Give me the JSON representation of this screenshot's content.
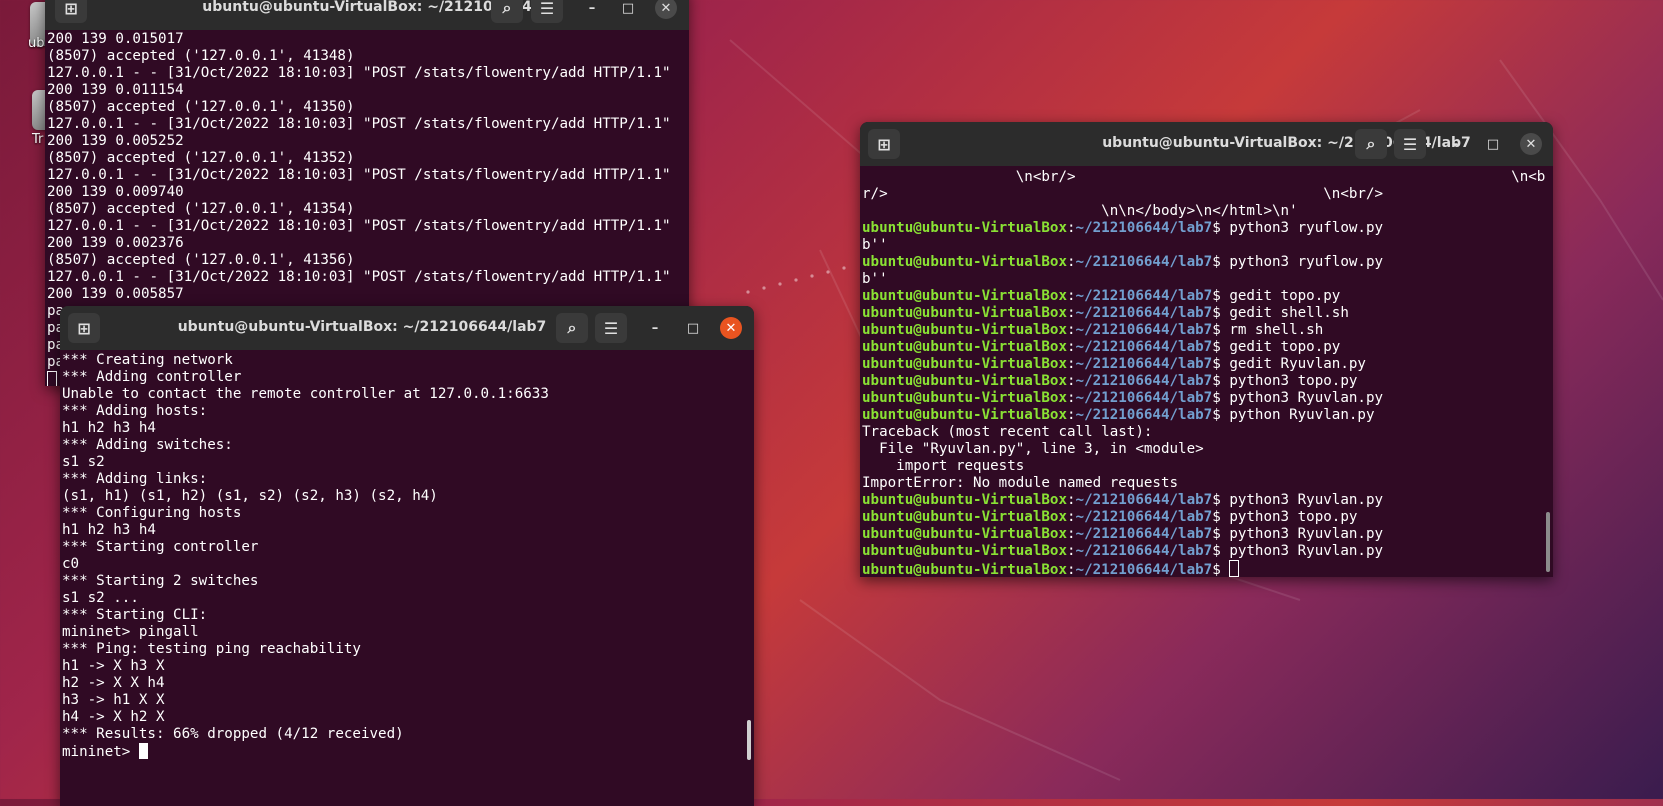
{
  "desktop": {
    "icons": [
      {
        "label": "ubu"
      },
      {
        "label": "Tr"
      }
    ]
  },
  "window_left_top": {
    "title": "ubuntu@ubuntu-VirtualBox: ~/212106644",
    "lines": [
      "200 139 0.015017",
      "(8507) accepted ('127.0.0.1', 41348)",
      "127.0.0.1 - - [31/Oct/2022 18:10:03] \"POST /stats/flowentry/add HTTP/1.1\"",
      "200 139 0.011154",
      "(8507) accepted ('127.0.0.1', 41350)",
      "127.0.0.1 - - [31/Oct/2022 18:10:03] \"POST /stats/flowentry/add HTTP/1.1\"",
      "200 139 0.005252",
      "(8507) accepted ('127.0.0.1', 41352)",
      "127.0.0.1 - - [31/Oct/2022 18:10:03] \"POST /stats/flowentry/add HTTP/1.1\"",
      "200 139 0.009740",
      "(8507) accepted ('127.0.0.1', 41354)",
      "127.0.0.1 - - [31/Oct/2022 18:10:03] \"POST /stats/flowentry/add HTTP/1.1\"",
      "200 139 0.002376",
      "(8507) accepted ('127.0.0.1', 41356)",
      "127.0.0.1 - - [31/Oct/2022 18:10:03] \"POST /stats/flowentry/add HTTP/1.1\"",
      "200 139 0.005857",
      "pa",
      "pa",
      "pa",
      "pa"
    ]
  },
  "window_bottom": {
    "title": "ubuntu@ubuntu-VirtualBox: ~/212106644/lab7",
    "lines": [
      "*** Creating network",
      "*** Adding controller",
      "Unable to contact the remote controller at 127.0.0.1:6633",
      "*** Adding hosts:",
      "h1 h2 h3 h4",
      "*** Adding switches:",
      "s1 s2",
      "*** Adding links:",
      "(s1, h1) (s1, h2) (s1, s2) (s2, h3) (s2, h4)",
      "*** Configuring hosts",
      "h1 h2 h3 h4",
      "*** Starting controller",
      "c0",
      "*** Starting 2 switches",
      "s1 s2 ...",
      "*** Starting CLI:",
      "mininet> pingall",
      "*** Ping: testing ping reachability",
      "h1 -> X h3 X",
      "h2 -> X X h4",
      "h3 -> h1 X X",
      "h4 -> X h2 X",
      "*** Results: 66% dropped (4/12 received)"
    ],
    "prompt": "mininet> "
  },
  "window_right": {
    "title": "ubuntu@ubuntu-VirtualBox: ~/212106644/lab7",
    "html_lines": [
      "                  \\n<br/>                                                   \\n<b",
      "r/>                                                   \\n<br/>",
      "                            \\n\\n</body>\\n</html>\\n'"
    ],
    "prompt_user": "ubuntu@ubuntu-VirtualBox",
    "prompt_path": "~/212106644/lab7",
    "entries": [
      {
        "type": "cmd",
        "text": "python3 ryuflow.py"
      },
      {
        "type": "out",
        "text": "b''"
      },
      {
        "type": "cmd",
        "text": "python3 ryuflow.py"
      },
      {
        "type": "out",
        "text": "b''"
      },
      {
        "type": "cmd",
        "text": "gedit topo.py"
      },
      {
        "type": "cmd",
        "text": "gedit shell.sh"
      },
      {
        "type": "cmd",
        "text": "rm shell.sh"
      },
      {
        "type": "cmd",
        "text": "gedit topo.py"
      },
      {
        "type": "cmd",
        "text": "gedit Ryuvlan.py"
      },
      {
        "type": "cmd",
        "text": "python3 topo.py"
      },
      {
        "type": "cmd",
        "text": "python3 Ryuvlan.py"
      },
      {
        "type": "cmd",
        "text": "python Ryuvlan.py"
      },
      {
        "type": "out",
        "text": "Traceback (most recent call last):"
      },
      {
        "type": "out",
        "text": "  File \"Ryuvlan.py\", line 3, in <module>"
      },
      {
        "type": "out",
        "text": "    import requests"
      },
      {
        "type": "out",
        "text": "ImportError: No module named requests"
      },
      {
        "type": "cmd",
        "text": "python3 Ryuvlan.py"
      },
      {
        "type": "cmd",
        "text": "python3 topo.py"
      },
      {
        "type": "cmd",
        "text": "python3 Ryuvlan.py"
      },
      {
        "type": "cmd",
        "text": "python3 Ryuvlan.py"
      },
      {
        "type": "cmd",
        "text": ""
      }
    ]
  }
}
